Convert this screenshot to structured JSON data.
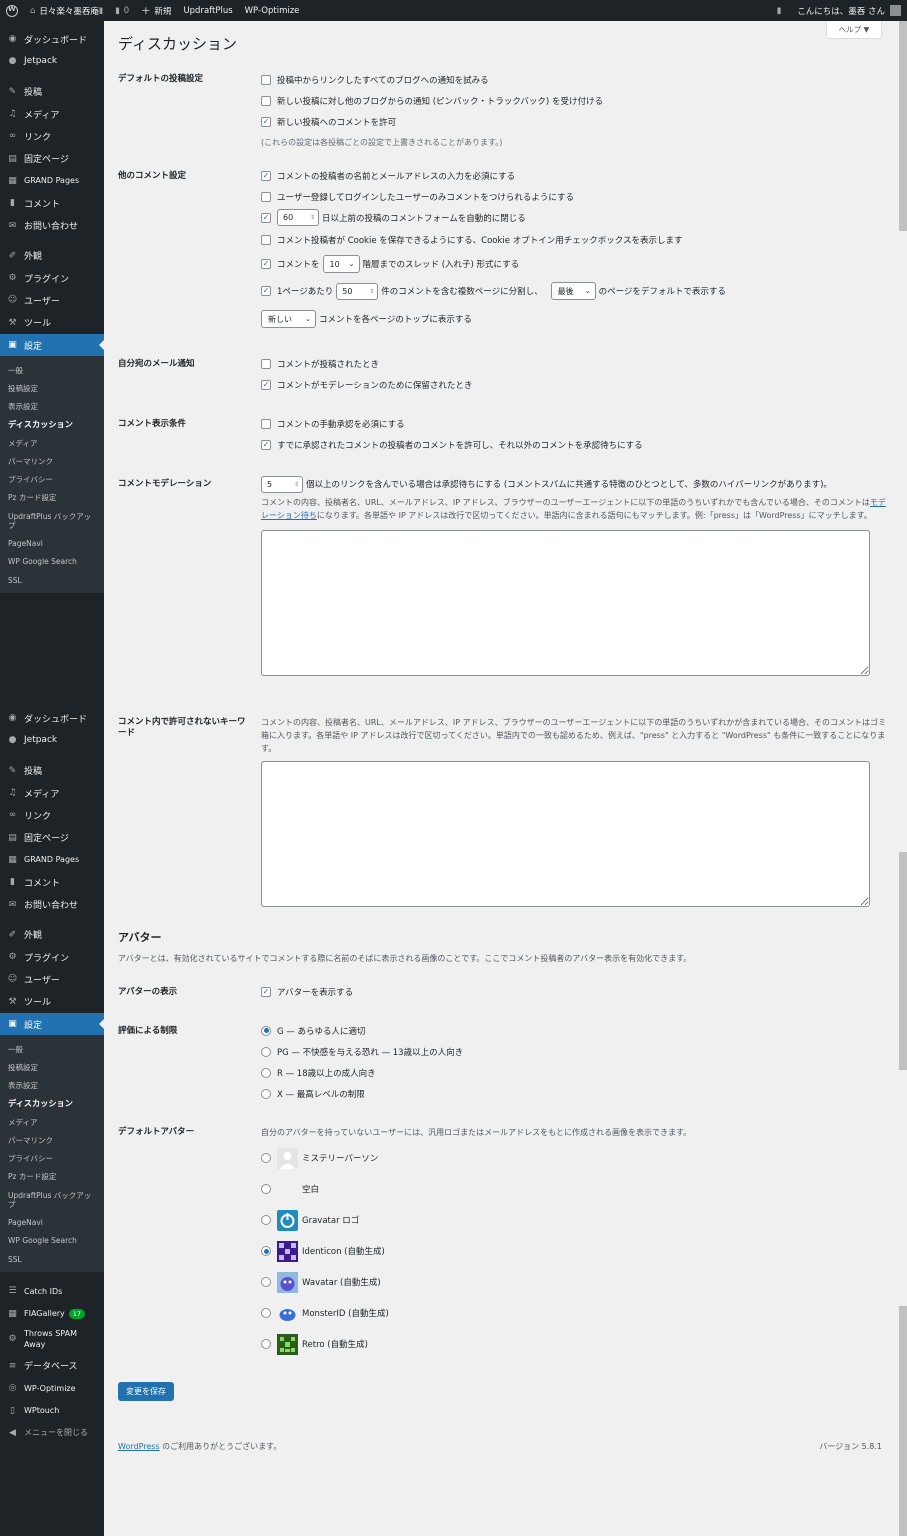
{
  "adminbar": {
    "site": "日々楽々墨吞庵Ⅱ",
    "comments": "0",
    "new": "新規",
    "plugin1": "UpdraftPlus",
    "plugin2": "WP-Optimize",
    "greeting": "こんにちは、墨吞 さん"
  },
  "menu": {
    "dashboard": "ダッシュボード",
    "jetpack": "Jetpack",
    "posts": "投稿",
    "media": "メディア",
    "links": "リンク",
    "pages": "固定ページ",
    "grand": "GRAND Pages",
    "comments": "コメント",
    "contact": "お問い合わせ",
    "appearance": "外観",
    "plugins": "プラグイン",
    "users": "ユーザー",
    "tools": "ツール",
    "settings": "設定"
  },
  "submenu": {
    "general": "一般",
    "writing": "投稿設定",
    "reading": "表示設定",
    "discussion": "ディスカッション",
    "media": "メディア",
    "permalink": "パーマリンク",
    "privacy": "プライバシー",
    "pz": "Pz カード設定",
    "updraft": "UpdraftPlus バックアップ",
    "pagenavi": "PageNavi",
    "wpgs": "WP Google Search",
    "ssl": "SSL"
  },
  "menu_extra": {
    "catchids": "Catch IDs",
    "fiagallery": "FIAGallery",
    "fiagallery_badge": "17",
    "throws": "Throws SPAM Away",
    "database": "データベース",
    "wpoptimize": "WP-Optimize",
    "wptouch": "WPtouch",
    "collapse": "メニューを閉じる"
  },
  "page": {
    "title": "ディスカッション",
    "help": "ヘルプ ▼"
  },
  "default_post": {
    "label": "デフォルトの投稿設定",
    "opt1": "投稿中からリンクしたすべてのブログへの通知を試みる",
    "opt2": "新しい投稿に対し他のブログからの通知 (ピンバック・トラックバック) を受け付ける",
    "opt3": "新しい投稿へのコメントを許可",
    "note": "(これらの設定は各投稿ごとの設定で上書きされることがあります。)"
  },
  "other": {
    "label": "他のコメント設定",
    "opt1": "コメントの投稿者の名前とメールアドレスの入力を必須にする",
    "opt2": "ユーザー登録してログインしたユーザーのみコメントをつけられるようにする",
    "days": "60",
    "opt3": "日以上前の投稿のコメントフォームを自動的に閉じる",
    "opt4": "コメント投稿者が Cookie を保存できるようにする、Cookie オプトイン用チェックボックスを表示します",
    "opt5a": "コメントを",
    "depth": "10",
    "opt5b": "階層までのスレッド (入れ子) 形式にする",
    "opt6a": "1ページあたり",
    "per_page": "50",
    "opt6b": "件のコメントを含む複数ページに分割し、",
    "page_sel": "最後",
    "opt6c": "のページをデフォルトで表示する",
    "order": "新しい",
    "opt7": "コメントを各ページのトップに表示する"
  },
  "email": {
    "label": "自分宛のメール通知",
    "opt1": "コメントが投稿されたとき",
    "opt2": "コメントがモデレーションのために保留されたとき"
  },
  "appear": {
    "label": "コメント表示条件",
    "opt1": "コメントの手動承認を必須にする",
    "opt2": "すでに承認されたコメントの投稿者のコメントを許可し、それ以外のコメントを承認待ちにする"
  },
  "moderation": {
    "label": "コメントモデレーション",
    "links": "5",
    "links_text": "個以上のリンクを含んでいる場合は承認待ちにする (コメントスパムに共通する特徴のひとつとして、多数のハイパーリンクがあります)。",
    "desc1": "コメントの内容、投稿者名、URL、メールアドレス、IP アドレス、ブラウザーのユーザーエージェントに以下の単語のうちいずれかでも含んでいる場合、そのコメントは",
    "desc_link": "モデレーション待ち",
    "desc2": "になります。各単語や IP アドレスは改行で区切ってください。単語内に含まれる語句にもマッチします。例:「press」は「WordPress」にマッチします。"
  },
  "disallowed": {
    "label": "コメント内で許可されないキーワード",
    "desc": "コメントの内容、投稿者名、URL、メールアドレス、IP アドレス、ブラウザーのユーザーエージェントに以下の単語のうちいずれかが含まれている場合、そのコメントはゴミ箱に入ります。各単語や IP アドレスは改行で区切ってください。単語内での一致も認めるため、例えば、\"press\" と入力すると \"WordPress\" も条件に一致することになります。"
  },
  "avatars": {
    "heading": "アバター",
    "desc": "アバターとは、有効化されているサイトでコメントする際に名前のそばに表示される画像のことです。ここでコメント投稿者のアバター表示を有効化できます。",
    "show_label": "アバターの表示",
    "show_opt": "アバターを表示する",
    "rating_label": "評価による制限",
    "ratings": [
      "G — あらゆる人に適切",
      "PG — 不快感を与える恐れ — 13歳以上の人向き",
      "R — 18歳以上の成人向き",
      "X — 最高レベルの制限"
    ],
    "default_label": "デフォルトアバター",
    "default_desc": "自分のアバターを持っていないユーザーには、汎用ロゴまたはメールアドレスをもとに作成される画像を表示できます。",
    "defaults": [
      "ミステリーパーソン",
      "空白",
      "Gravatar ロゴ",
      "Identicon (自動生成)",
      "Wavatar (自動生成)",
      "MonsterID (自動生成)",
      "Retro (自動生成)"
    ]
  },
  "save": "変更を保存",
  "footer": {
    "link": "WordPress",
    "thanks": " のご利用ありがとうございます。",
    "version": "バージョン 5.8.1"
  }
}
